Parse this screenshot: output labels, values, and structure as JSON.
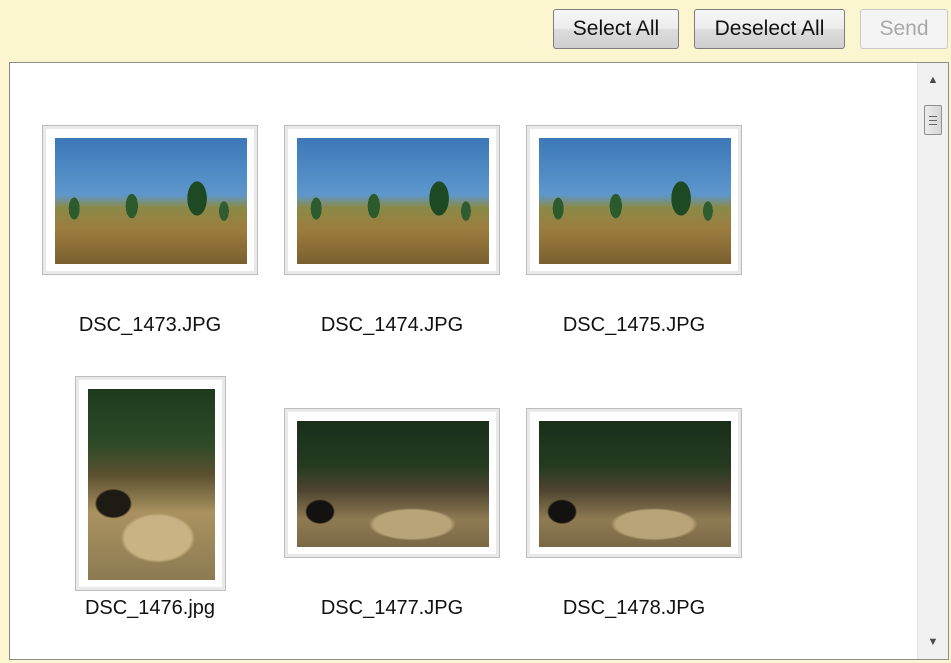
{
  "toolbar": {
    "select_all": "Select All",
    "deselect_all": "Deselect All",
    "send": "Send"
  },
  "scrollbar": {
    "up_arrow": "▲",
    "down_arrow": "▼",
    "position_fraction": 0.0
  },
  "images": [
    {
      "filename": "DSC_1473.JPG",
      "orientation": "landscape"
    },
    {
      "filename": "DSC_1474.JPG",
      "orientation": "landscape"
    },
    {
      "filename": "DSC_1475.JPG",
      "orientation": "landscape"
    },
    {
      "filename": "DSC_1476.jpg",
      "orientation": "portrait"
    },
    {
      "filename": "DSC_1477.JPG",
      "orientation": "landscape"
    },
    {
      "filename": "DSC_1478.JPG",
      "orientation": "landscape"
    }
  ],
  "colors": {
    "toolbar_background": "#fbf6d0",
    "panel_background": "#ffffff",
    "disabled_text": "#a8a8a8"
  }
}
